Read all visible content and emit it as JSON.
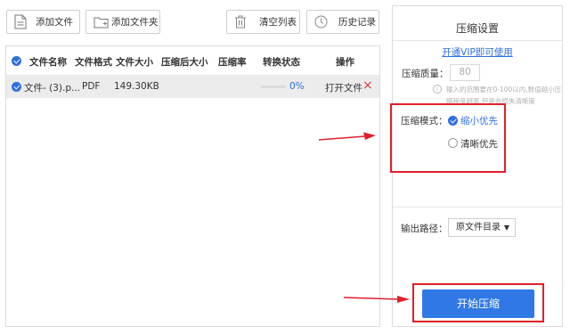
{
  "toolbar": {
    "add_file": "添加文件",
    "add_folder": "添加文件夹",
    "clear_list": "清空列表",
    "history": "历史记录"
  },
  "table": {
    "headers": [
      "文件名称",
      "文件格式",
      "文件大小",
      "压缩后大小",
      "压缩率",
      "转换状态",
      "操作"
    ],
    "rows": [
      {
        "name": "文件- (3).p...",
        "format": "PDF",
        "size": "149.30KB",
        "compressed_size": "",
        "rate": "",
        "progress": "0%",
        "open_label": "打开文件",
        "delete_icon": "×"
      }
    ]
  },
  "settings": {
    "title": "压缩设置",
    "vip_link": "开通VIP即可使用",
    "quality_label": "压缩质量：",
    "quality_value": "80",
    "quality_hint": "输入的范围要在0-100以内,数值越小压缩程度越高,但是会损失清晰度",
    "mode_label": "压缩模式：",
    "mode_options": [
      "缩小优先",
      "清晰优先"
    ],
    "mode_selected": "缩小优先",
    "output_label": "输出路径：",
    "output_value": "原文件目录",
    "start_button": "开始压缩"
  },
  "colors": {
    "accent": "#2f78e6",
    "annotation": "#e0202a",
    "delete": "#e03a3a"
  }
}
